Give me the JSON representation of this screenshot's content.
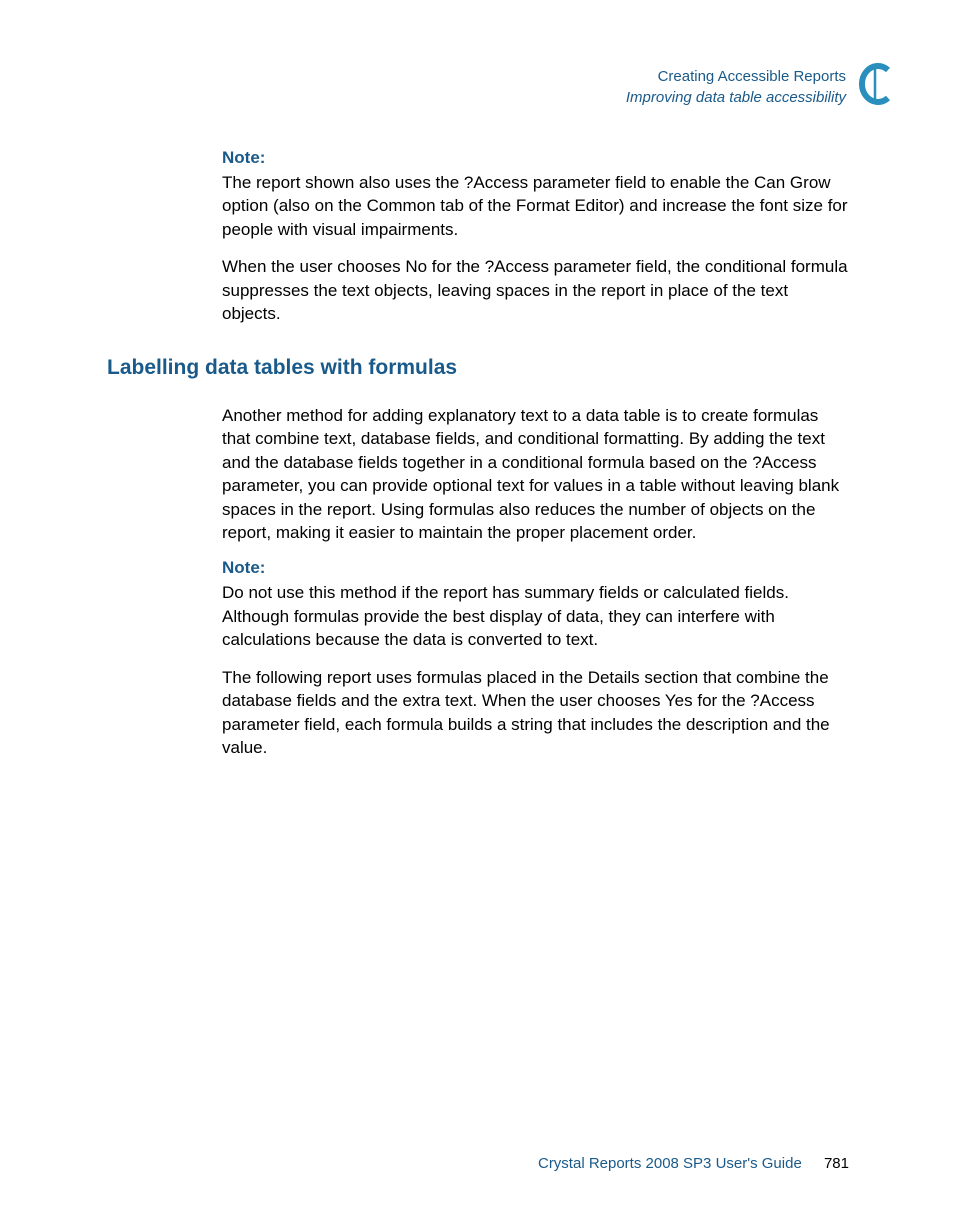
{
  "header": {
    "line1": "Creating Accessible Reports",
    "line2": "Improving data table accessibility",
    "appendix": "C"
  },
  "content": {
    "note1_label": "Note:",
    "note1_text": "The report shown also uses the ?Access parameter field to enable the Can Grow option (also on the Common tab of the Format Editor) and increase the font size for people with visual impairments.",
    "para1": "When the user chooses No for the ?Access parameter field, the conditional formula suppresses the text objects, leaving spaces in the report in place of the text objects.",
    "heading": "Labelling data tables with formulas",
    "para2": "Another method for adding explanatory text to a data table is to create formulas that combine text, database fields, and conditional formatting. By adding the text and the database fields together in a conditional formula based on the ?Access parameter, you can provide optional text for values in a table without leaving blank spaces in the report. Using formulas also reduces the number of objects on the report, making it easier to maintain the proper placement order.",
    "note2_label": "Note:",
    "note2_text": "Do not use this method if the report has summary fields or calculated fields. Although formulas provide the best display of data, they can interfere with calculations because the data is converted to text.",
    "para3": "The following report uses formulas placed in the Details section that combine the database fields and the extra text. When the user chooses Yes for the ?Access parameter field, each formula builds a string that includes the description and the value."
  },
  "footer": {
    "title": "Crystal Reports 2008 SP3 User's Guide",
    "page": "781"
  }
}
